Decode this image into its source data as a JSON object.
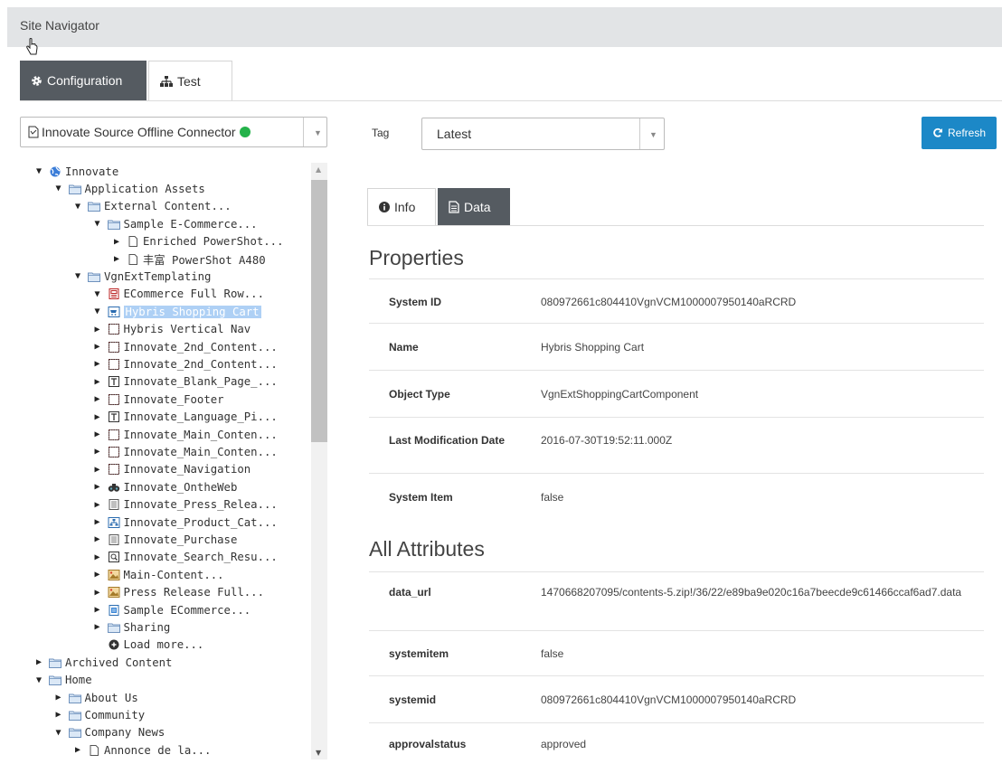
{
  "header": {
    "title": "Site Navigator"
  },
  "tabs": {
    "configuration": "Configuration",
    "test": "Test"
  },
  "connector": {
    "label": "Innovate Source Offline Connector",
    "status_color": "#24b24a"
  },
  "tree": {
    "items": [
      {
        "label": "Innovate",
        "arrow": "▼",
        "icon": "globe"
      },
      {
        "label": "Application Assets",
        "arrow": "▼",
        "icon": "folder"
      },
      {
        "label": "External Content...",
        "arrow": "▼",
        "icon": "folder"
      },
      {
        "label": "Sample E-Commerce...",
        "arrow": "▼",
        "icon": "folder"
      },
      {
        "label": "Enriched PowerShot...",
        "arrow": "▶",
        "icon": "page"
      },
      {
        "label": "丰富 PowerShot A480",
        "arrow": "▶",
        "icon": "page"
      },
      {
        "label": "VgnExtTemplating",
        "arrow": "▼",
        "icon": "folder"
      },
      {
        "label": "ECommerce Full Row...",
        "arrow": "▼",
        "icon": "template"
      },
      {
        "label": "Hybris Shopping Cart",
        "arrow": "▼",
        "icon": "cart"
      },
      {
        "label": "Hybris Vertical Nav",
        "arrow": "▶",
        "icon": "frame"
      },
      {
        "label": "Innovate_2nd_Content...",
        "arrow": "▶",
        "icon": "frame"
      },
      {
        "label": "Innovate_2nd_Content...",
        "arrow": "▶",
        "icon": "frame"
      },
      {
        "label": "Innovate_Blank_Page_...",
        "arrow": "▶",
        "icon": "text"
      },
      {
        "label": "Innovate_Footer",
        "arrow": "▶",
        "icon": "frame"
      },
      {
        "label": "Innovate_Language_Pi...",
        "arrow": "▶",
        "icon": "text"
      },
      {
        "label": "Innovate_Main_Conten...",
        "arrow": "▶",
        "icon": "frame"
      },
      {
        "label": "Innovate_Main_Conten...",
        "arrow": "▶",
        "icon": "frame"
      },
      {
        "label": "Innovate_Navigation",
        "arrow": "▶",
        "icon": "frame"
      },
      {
        "label": "Innovate_OntheWeb",
        "arrow": "▶",
        "icon": "binoculars"
      },
      {
        "label": "Innovate_Press_Relea...",
        "arrow": "▶",
        "icon": "doc"
      },
      {
        "label": "Innovate_Product_Cat...",
        "arrow": "▶",
        "icon": "tree"
      },
      {
        "label": "Innovate_Purchase",
        "arrow": "▶",
        "icon": "doc"
      },
      {
        "label": "Innovate_Search_Resu...",
        "arrow": "▶",
        "icon": "search"
      },
      {
        "label": "Main-Content...",
        "arrow": "▶",
        "icon": "image"
      },
      {
        "label": "Press Release Full...",
        "arrow": "▶",
        "icon": "image"
      },
      {
        "label": "Sample ECommerce...",
        "arrow": "▶",
        "icon": "blue-doc"
      },
      {
        "label": "Sharing",
        "arrow": "▶",
        "icon": "folder"
      },
      {
        "label": "Load more...",
        "arrow": "",
        "icon": "plus"
      },
      {
        "label": "Archived Content",
        "arrow": "▶",
        "icon": "folder"
      },
      {
        "label": "Home",
        "arrow": "▼",
        "icon": "folder"
      },
      {
        "label": "About Us",
        "arrow": "▶",
        "icon": "folder"
      },
      {
        "label": "Community",
        "arrow": "▶",
        "icon": "folder"
      },
      {
        "label": "Company News",
        "arrow": "▼",
        "icon": "folder"
      },
      {
        "label": "Annonce de la...",
        "arrow": "▶",
        "icon": "page"
      }
    ]
  },
  "tag": {
    "label": "Tag",
    "value": "Latest"
  },
  "refresh": {
    "label": "Refresh"
  },
  "detail_tabs": {
    "info": "Info",
    "data": "Data"
  },
  "properties": {
    "title": "Properties",
    "rows": [
      {
        "key": "System ID",
        "value": "080972661c804410VgnVCM1000007950140aRCRD"
      },
      {
        "key": "Name",
        "value": "Hybris Shopping Cart"
      },
      {
        "key": "Object Type",
        "value": "VgnExtShoppingCartComponent"
      },
      {
        "key": "Last Modification Date",
        "value": "2016-07-30T19:52:11.000Z"
      },
      {
        "key": "System Item",
        "value": "false"
      }
    ]
  },
  "attributes": {
    "title": "All Attributes",
    "rows": [
      {
        "key": "data_url",
        "value": "1470668207095/contents-5.zip!/36/22/e89ba9e020c16a7beecde9c61466ccaf6ad7.data"
      },
      {
        "key": "systemitem",
        "value": "false"
      },
      {
        "key": "systemid",
        "value": "080972661c804410VgnVCM1000007950140aRCRD"
      },
      {
        "key": "approvalstatus",
        "value": "approved"
      }
    ]
  }
}
